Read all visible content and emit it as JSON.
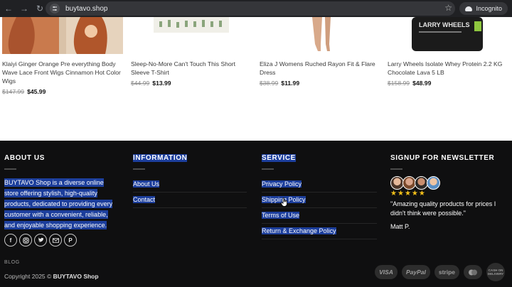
{
  "browser": {
    "url": "buytavo.shop",
    "incognito_label": "Incognito",
    "icons": [
      "back-arrow-icon",
      "forward-arrow-icon",
      "reload-icon",
      "site-settings-icon",
      "bookmark-star-icon",
      "incognito-icon"
    ]
  },
  "products": [
    {
      "title": "Klaiyi Ginger Orange Pre everything Body Wave Lace Front Wigs Cinnamon Hot Color Wigs",
      "old_price": "$147.99",
      "price": "$45.99"
    },
    {
      "title": "Sleep-No-More Can't Touch This Short Sleeve T-Shirt",
      "old_price": "$44.99",
      "price": "$13.99"
    },
    {
      "title": "Eliza J Womens Ruched Rayon Fit & Flare Dress",
      "old_price": "$38.99",
      "price": "$11.99"
    },
    {
      "title": "Larry Wheels Isolate Whey Protein 2.2 KG Chocolate Lava 5 LB",
      "old_price": "$158.99",
      "price": "$48.99",
      "image_text": "LARRY WHEELS"
    }
  ],
  "footer": {
    "about": {
      "title": "ABOUT US",
      "lines": [
        "BUYTAVO Shop is a diverse online",
        "store offering stylish, high-quality",
        "products, dedicated to providing every",
        "customer with a convenient, reliable,",
        "and enjoyable shopping experience."
      ],
      "social_icons": [
        "facebook-icon",
        "instagram-icon",
        "twitter-icon",
        "email-icon",
        "pinterest-icon"
      ]
    },
    "information": {
      "title": "INFORMATION",
      "links": [
        "About Us",
        "Contact"
      ]
    },
    "service": {
      "title": "SERVICE",
      "links": [
        "Privacy Policy",
        "Shipping Policy",
        "Terms of Use",
        "Return & Exchange Policy"
      ]
    },
    "newsletter": {
      "title": "SIGNUP FOR NEWSLETTER",
      "quote": "\"Amazing quality products for prices I didn't think were possible.\"",
      "author": "Matt P.",
      "rating": 5
    },
    "blog": "BLOG",
    "copyright_prefix": "Copyright 2025 ©",
    "copyright_brand": "BUYTAVO Shop",
    "payments": [
      "VISA",
      "PayPal",
      "stripe"
    ],
    "cod_label": "CASH ON DELIVERY"
  },
  "colors": {
    "footer_bg": "#0f0f10",
    "selection": "#1c3e9c",
    "star": "#f6c019"
  }
}
